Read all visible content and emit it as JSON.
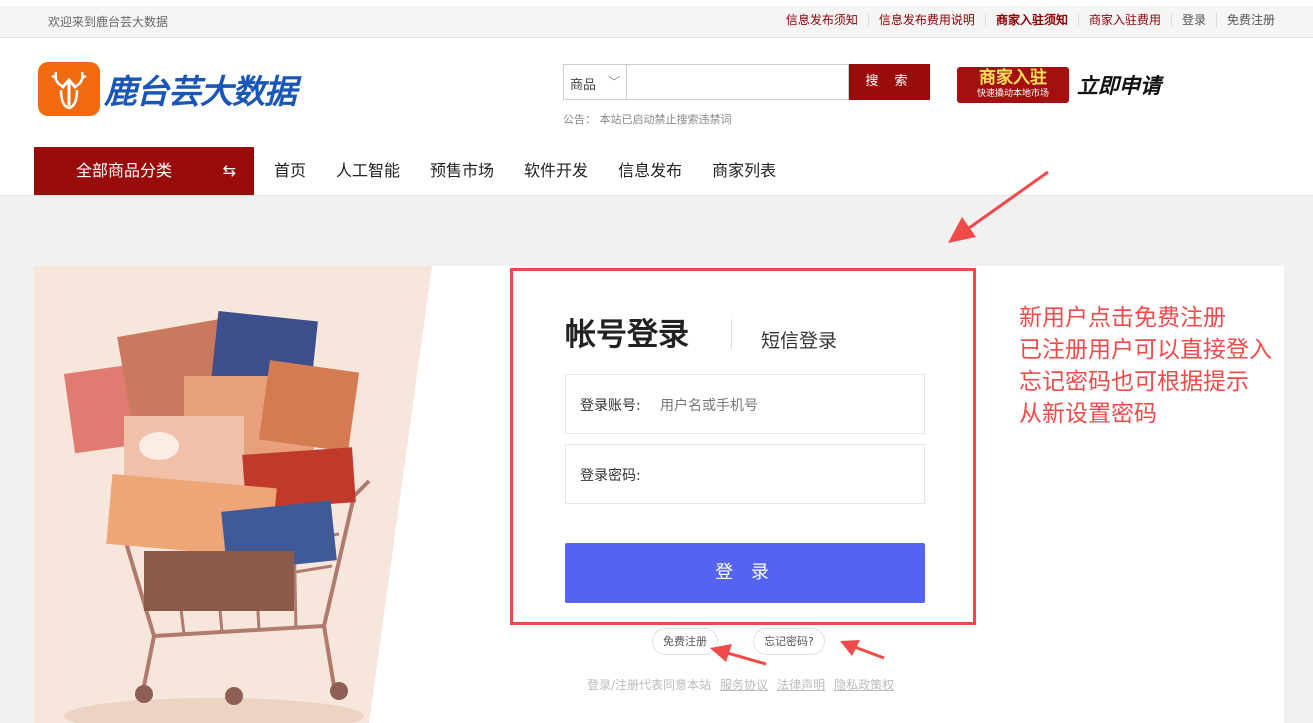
{
  "topbar": {
    "welcome": "欢迎来到鹿台芸大数据",
    "links": [
      "信息发布须知",
      "信息发布费用说明",
      "商家入驻须知",
      "商家入驻费用",
      "登录",
      "免费注册"
    ]
  },
  "header": {
    "logo_text": "鹿台芸大数据",
    "search": {
      "category": "商品",
      "button": "搜 索",
      "notice": "公告：  本站已启动禁止搜索违禁词"
    },
    "merchant": {
      "title": "商家入驻",
      "subtitle": "快速撬动本地市场",
      "apply": "立即申请"
    }
  },
  "nav": {
    "all_categories": "全部商品分类",
    "items": [
      "首页",
      "人工智能",
      "预售市场",
      "软件开发",
      "信息发布",
      "商家列表"
    ]
  },
  "login": {
    "title": "帐号登录",
    "sms_tab": "短信登录",
    "account_label": "登录账号:",
    "account_placeholder": "用户名或手机号",
    "password_label": "登录密码:",
    "button": "登 录",
    "register": "免费注册",
    "forgot": "忘记密码?",
    "terms_prefix": "登录/注册代表同意本站",
    "terms_links": [
      "服务协议",
      "法律声明",
      "隐私政策权"
    ]
  },
  "annotation": {
    "lines": [
      "新用户点击免费注册",
      "已注册用户可以直接登入",
      "忘记密码也可根据提示",
      "从新设置密码"
    ]
  },
  "colors": {
    "brand_red": "#9a0c0c",
    "login_blue": "#5464f0",
    "annotation_red": "#f04a4a",
    "logo_blue": "#1a56b8",
    "logo_orange": "#f26a0f"
  }
}
